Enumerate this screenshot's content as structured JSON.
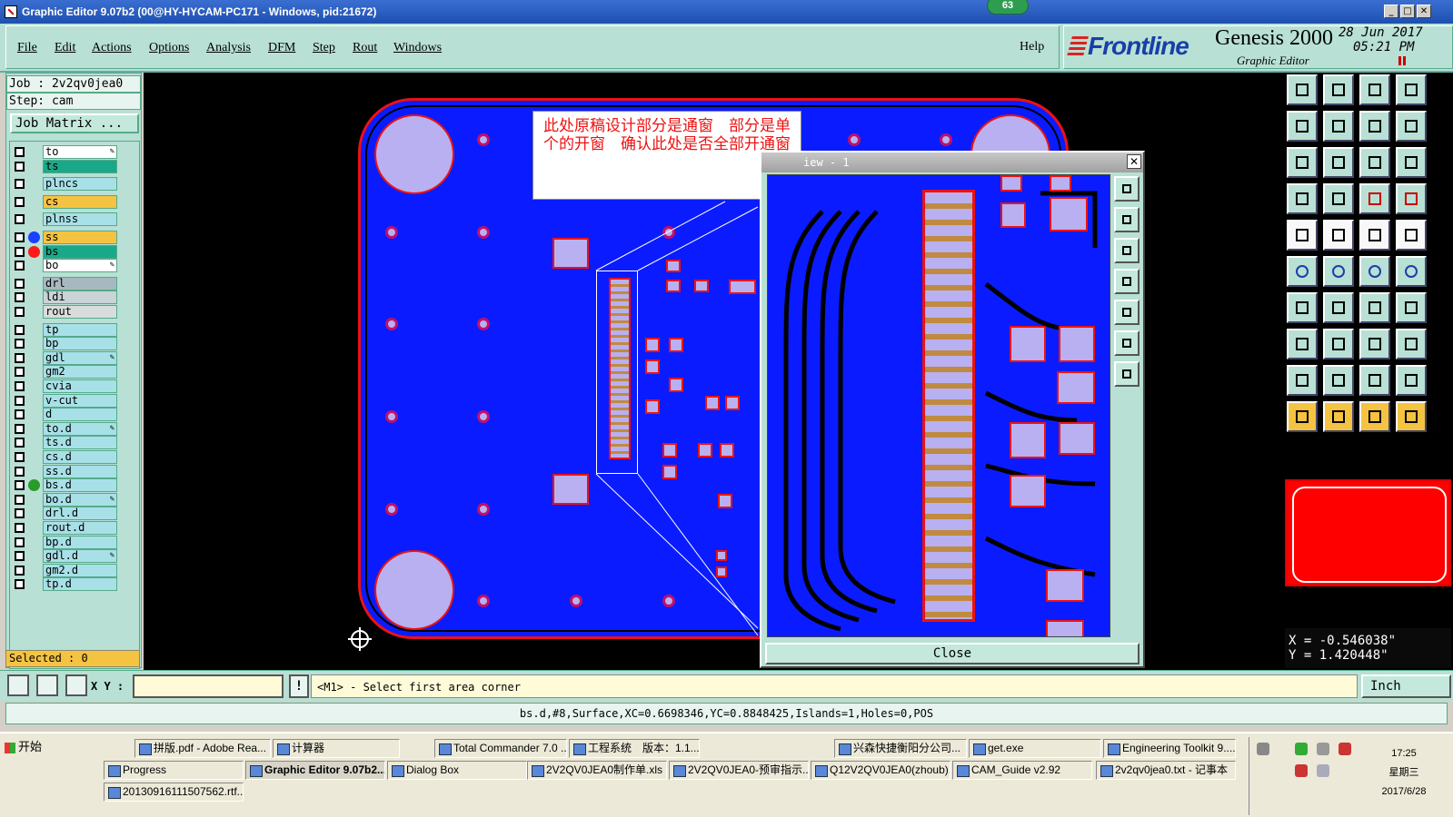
{
  "window": {
    "title": "Graphic Editor 9.07b2 (00@HY-HYCAM-PC171 - Windows, pid:21672)",
    "badge": "63"
  },
  "menu": {
    "items": [
      "File",
      "Edit",
      "Actions",
      "Options",
      "Analysis",
      "DFM",
      "Step",
      "Rout",
      "Windows"
    ],
    "help": "Help"
  },
  "brand": {
    "logo": "Frontline",
    "product": "Genesis 2000",
    "subtitle": "Graphic Editor",
    "date": "28 Jun 2017",
    "time": "05:21 PM"
  },
  "left": {
    "job": "Job : 2v2qv0jea0",
    "step": "Step: cam",
    "job_matrix": "Job Matrix ...",
    "selected": "Selected : 0",
    "layers": [
      {
        "name": "to",
        "color": "#ffffff",
        "dot": "",
        "edit": true
      },
      {
        "name": "ts",
        "color": "#1aa88a",
        "dot": "",
        "edit": false
      },
      {
        "name": "plncs",
        "color": "#a8e0e8",
        "dot": "",
        "edit": false
      },
      {
        "name": "cs",
        "color": "#f5c342",
        "dot": "",
        "edit": false
      },
      {
        "name": "plnss",
        "color": "#a8e0e8",
        "dot": "",
        "edit": false
      },
      {
        "name": "ss",
        "color": "#f5c342",
        "dot": "#1a3fff",
        "edit": false
      },
      {
        "name": "bs",
        "color": "#1aa88a",
        "dot": "#ff1a1a",
        "edit": false
      },
      {
        "name": "bo",
        "color": "#ffffff",
        "dot": "",
        "edit": true
      },
      {
        "name": "drl",
        "color": "#a8b8c0",
        "dot": "",
        "edit": false
      },
      {
        "name": "ldi",
        "color": "#c8d4d8",
        "dot": "",
        "edit": false
      },
      {
        "name": "rout",
        "color": "#d8dcdc",
        "dot": "",
        "edit": false
      },
      {
        "name": "tp",
        "color": "#a8e0e8",
        "dot": "",
        "edit": false
      },
      {
        "name": "bp",
        "color": "#a8e0e8",
        "dot": "",
        "edit": false
      },
      {
        "name": "gdl",
        "color": "#a8e0e8",
        "dot": "",
        "edit": true
      },
      {
        "name": "gm2",
        "color": "#a8e0e8",
        "dot": "",
        "edit": false
      },
      {
        "name": "cvia",
        "color": "#a8e0e8",
        "dot": "",
        "edit": false
      },
      {
        "name": "v-cut",
        "color": "#a8e0e8",
        "dot": "",
        "edit": false
      },
      {
        "name": "d",
        "color": "#a8e0e8",
        "dot": "",
        "edit": false
      },
      {
        "name": "to.d",
        "color": "#a8e0e8",
        "dot": "",
        "edit": true
      },
      {
        "name": "ts.d",
        "color": "#a8e0e8",
        "dot": "",
        "edit": false
      },
      {
        "name": "cs.d",
        "color": "#a8e0e8",
        "dot": "",
        "edit": false
      },
      {
        "name": "ss.d",
        "color": "#a8e0e8",
        "dot": "",
        "edit": false
      },
      {
        "name": "bs.d",
        "color": "#a8e0e8",
        "dot": "#2a9a2a",
        "edit": false
      },
      {
        "name": "bo.d",
        "color": "#a8e0e8",
        "dot": "",
        "edit": true
      },
      {
        "name": "drl.d",
        "color": "#a8e0e8",
        "dot": "",
        "edit": false
      },
      {
        "name": "rout.d",
        "color": "#a8e0e8",
        "dot": "",
        "edit": false
      },
      {
        "name": "bp.d",
        "color": "#a8e0e8",
        "dot": "",
        "edit": false
      },
      {
        "name": "gdl.d",
        "color": "#a8e0e8",
        "dot": "",
        "edit": true
      },
      {
        "name": "gm2.d",
        "color": "#a8e0e8",
        "dot": "",
        "edit": false
      },
      {
        "name": "tp.d",
        "color": "#a8e0e8",
        "dot": "",
        "edit": false
      }
    ]
  },
  "annotation": {
    "text": "此处原稿设计部分是通窗　部分是单个的开窗　确认此处是否全部开通窗"
  },
  "zoom": {
    "title": "iew - 1",
    "close_x": "✕",
    "close_button": "Close"
  },
  "coords": {
    "x": "X = -0.546038\"",
    "y": "Y = 1.420448\""
  },
  "command": {
    "xy_label": "X Y :",
    "bang": "!",
    "prompt": "<M1> - Select first area corner",
    "units": "Inch"
  },
  "status": "bs.d,#8,Surface,XC=0.6698346,YC=0.8848425,Islands=1,Holes=0,POS",
  "taskbar": {
    "start": "开始",
    "row1": [
      "拼版.pdf - Adobe Rea...",
      "计算器",
      "Total Commander 7.0 ...",
      "工程系统　版本：1.1...",
      "兴森快捷衡阳分公司...",
      "get.exe",
      "Engineering Toolkit 9...."
    ],
    "row2": [
      "Progress",
      "Graphic Editor 9.07b2...",
      "Dialog Box",
      "2V2QV0JEA0制作单.xls ...",
      "2V2QV0JEA0-预审指示....",
      "Q12V2QV0JEA0(zhoub)...",
      "CAM_Guide v2.92",
      "2v2qv0jea0.txt - 记事本"
    ],
    "row3": [
      "20130916111507562.rtf..."
    ],
    "clock_time": "17:25",
    "clock_day": "星期三",
    "clock_date": "2017/6/28"
  },
  "colors": {
    "board": "#0a1cff",
    "panel": "#b8e0d4",
    "highlight": "#f5c342",
    "pad": "#b8b0f0",
    "outline": "#e11111"
  }
}
